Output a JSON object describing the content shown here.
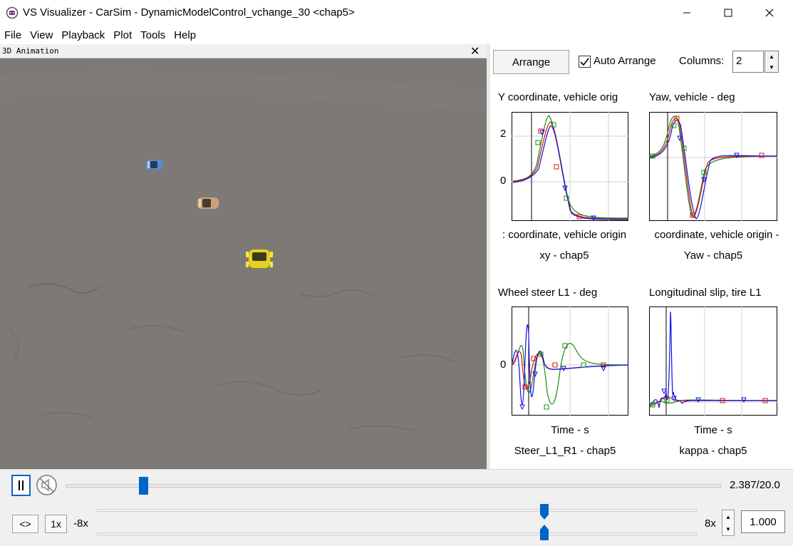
{
  "window": {
    "title": "VS Visualizer - CarSim - DynamicModelControl_vchange_30 <chap5>"
  },
  "menu": [
    "File",
    "View",
    "Playback",
    "Plot",
    "Tools",
    "Help"
  ],
  "animation": {
    "panel_title": "3D Animation",
    "close_glyph": "✕"
  },
  "plot_panel": {
    "arrange_label": "Arrange",
    "auto_arrange_label": "Auto Arrange",
    "auto_arrange_checked": true,
    "columns_label": "Columns:",
    "columns_value": "2"
  },
  "plots": [
    {
      "title": "Y coordinate, vehicle orig",
      "xlabel": ": coordinate, vehicle origin",
      "caption": "xy - chap5",
      "yticks": [
        "2",
        "0"
      ]
    },
    {
      "title": "Yaw, vehicle - deg",
      "xlabel": "coordinate, vehicle origin -",
      "caption": "Yaw - chap5",
      "yticks": []
    },
    {
      "title": "Wheel steer L1 - deg",
      "xlabel": "Time - s",
      "caption": "Steer_L1_R1 - chap5",
      "yticks": [
        "0"
      ]
    },
    {
      "title": "Longitudinal slip, tire L1",
      "xlabel": "Time - s",
      "caption": "kappa - chap5",
      "yticks": []
    }
  ],
  "playback": {
    "time_readout": "2.387/20.0",
    "time_progress": 0.119,
    "loop_label": "<>",
    "speed_reset_label": "1x",
    "min_speed_label": "-8x",
    "max_speed_label": "8x",
    "speed_value": "1.000",
    "speed_position": 0.5
  },
  "colors": {
    "accent": "#0064c8",
    "series_red": "#e01010",
    "series_blue": "#1010e0",
    "series_green": "#109010"
  }
}
